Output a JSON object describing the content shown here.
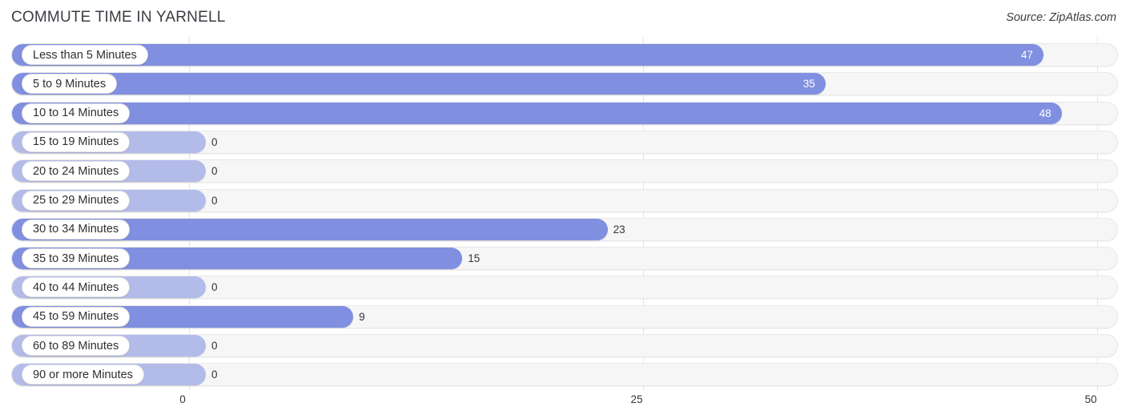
{
  "header": {
    "title": "COMMUTE TIME IN YARNELL",
    "source": "Source: ZipAtlas.com"
  },
  "colors": {
    "bar": "#808fe0",
    "bar_zero": "#b3bbe9",
    "track": "#f6f6f7",
    "pill": "#ffffff",
    "text": "#33333a",
    "gridline": "#e3e3e6"
  },
  "chart_data": {
    "type": "bar",
    "orientation": "horizontal",
    "title": "COMMUTE TIME IN YARNELL",
    "xlabel": "",
    "ylabel": "",
    "xlim": [
      0,
      50
    ],
    "grid": true,
    "legend": null,
    "xticks": [
      "0",
      "25",
      "50"
    ],
    "xtick_values": [
      0,
      25,
      50
    ],
    "categories": [
      "Less than 5 Minutes",
      "5 to 9 Minutes",
      "10 to 14 Minutes",
      "15 to 19 Minutes",
      "20 to 24 Minutes",
      "25 to 29 Minutes",
      "30 to 34 Minutes",
      "35 to 39 Minutes",
      "40 to 44 Minutes",
      "45 to 59 Minutes",
      "60 to 89 Minutes",
      "90 or more Minutes"
    ],
    "values": [
      47,
      35,
      48,
      0,
      0,
      0,
      23,
      15,
      0,
      9,
      0,
      0
    ],
    "value_labels": [
      "47",
      "35",
      "48",
      "0",
      "0",
      "0",
      "23",
      "15",
      "0",
      "9",
      "0",
      "0"
    ]
  }
}
